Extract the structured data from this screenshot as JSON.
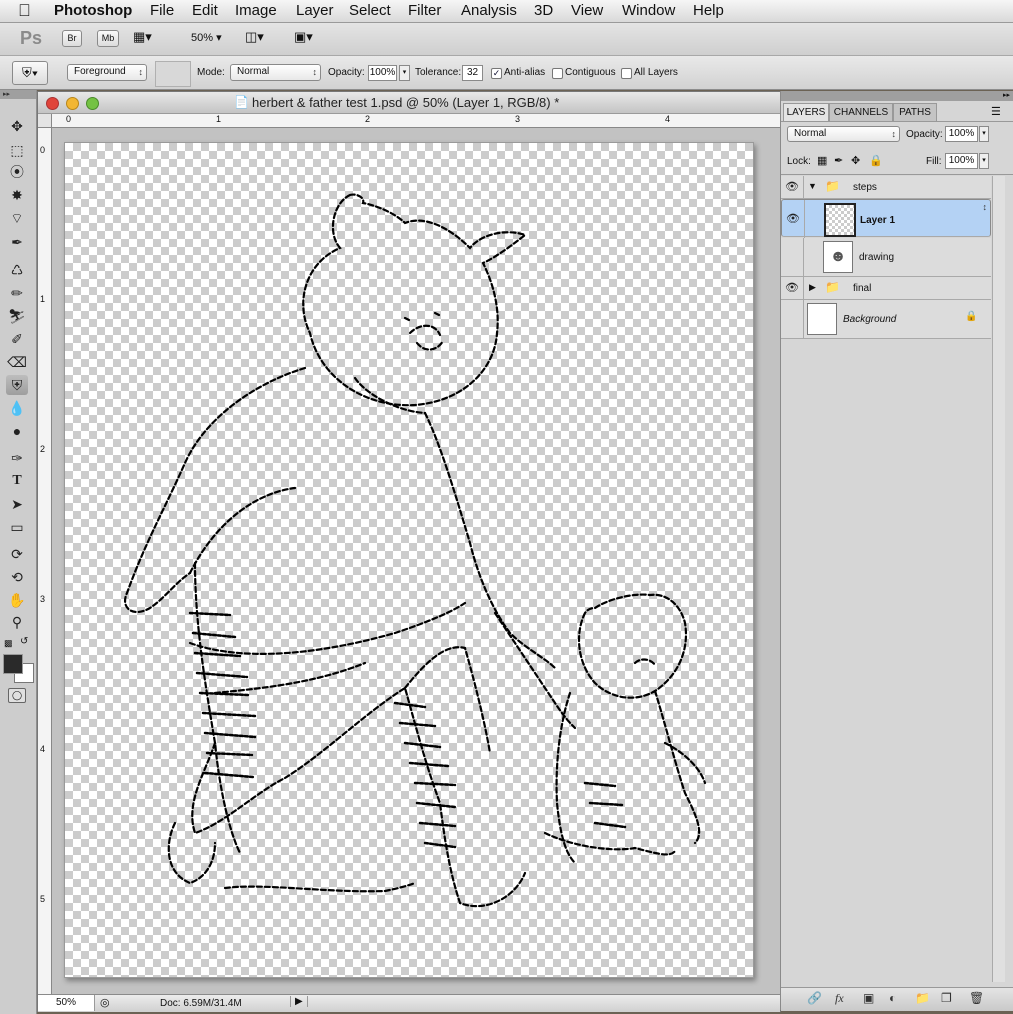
{
  "menubar": {
    "apple": "",
    "app": "Photoshop",
    "items": [
      "File",
      "Edit",
      "Image",
      "Layer",
      "Select",
      "Filter",
      "Analysis",
      "3D",
      "View",
      "Window",
      "Help"
    ]
  },
  "appbar": {
    "ps_logo": "Ps",
    "bridge": "Br",
    "minibridge": "Mb",
    "zoom": "50%"
  },
  "options": {
    "tool_icon": "paint-bucket-icon",
    "fill_source": "Foreground",
    "mode_label": "Mode:",
    "mode_value": "Normal",
    "opacity_label": "Opacity:",
    "opacity_value": "100%",
    "tolerance_label": "Tolerance:",
    "tolerance_value": "32",
    "antialias_label": "Anti-alias",
    "antialias_checked": true,
    "contiguous_label": "Contiguous",
    "contiguous_checked": false,
    "alllayers_label": "All Layers",
    "alllayers_checked": false
  },
  "document": {
    "title": "herbert & father test 1.psd @ 50% (Layer 1, RGB/8) *",
    "ruler_h": [
      "0",
      "1",
      "2",
      "3",
      "4"
    ],
    "ruler_v": [
      "0",
      "1",
      "2",
      "3",
      "4",
      "5"
    ],
    "status_zoom": "50%",
    "status_doc": "Doc: 6.59M/31.4M"
  },
  "layers_panel": {
    "tabs": [
      "LAYERS",
      "CHANNELS",
      "PATHS"
    ],
    "blend_mode": "Normal",
    "opacity_label": "Opacity:",
    "opacity_value": "100%",
    "lock_label": "Lock:",
    "fill_label": "Fill:",
    "fill_value": "100%",
    "layers": [
      {
        "name": "steps",
        "type": "group",
        "expanded": true,
        "visible": true
      },
      {
        "name": "Layer 1",
        "type": "layer",
        "selected": true,
        "visible": true
      },
      {
        "name": "drawing",
        "type": "layer",
        "visible": false
      },
      {
        "name": "final",
        "type": "group",
        "expanded": false,
        "visible": true
      },
      {
        "name": "Background",
        "type": "background",
        "visible": false,
        "locked": true
      }
    ]
  },
  "colors": {
    "selection": "#b4d2f4",
    "foreground": "#2a2a2a",
    "background": "#ffffff"
  }
}
